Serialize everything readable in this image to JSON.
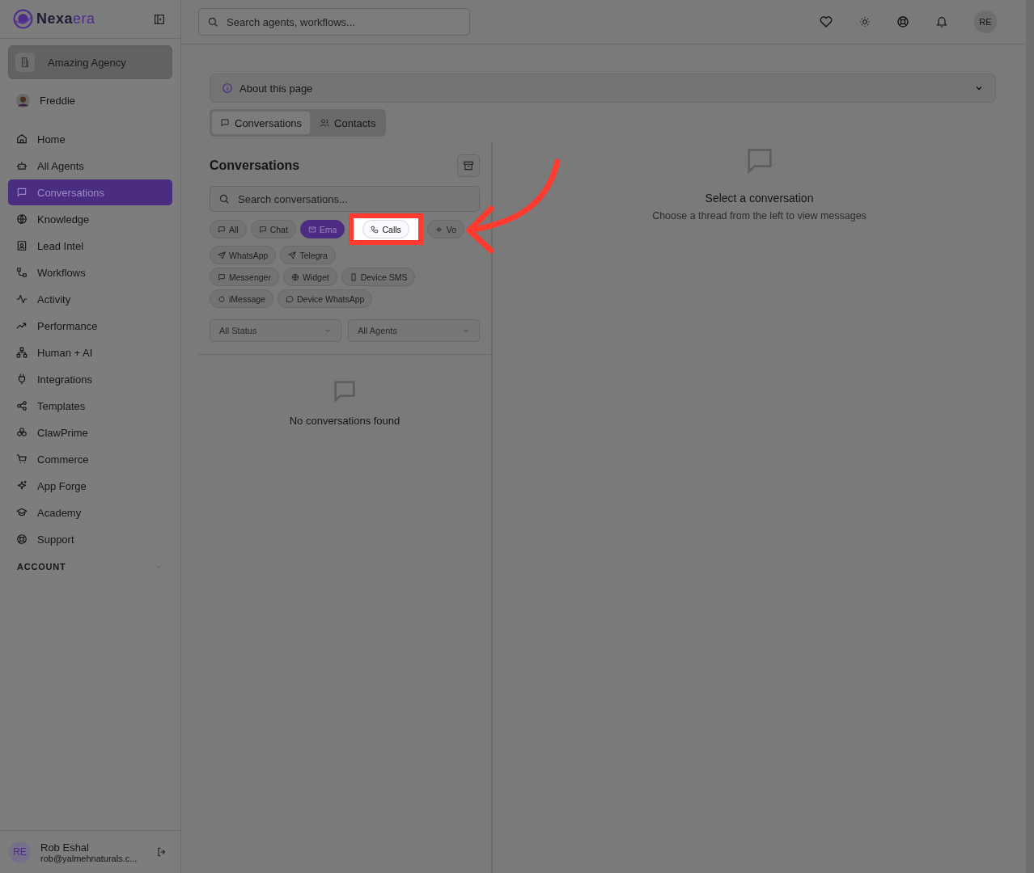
{
  "sidebar": {
    "brand": [
      "Nexa",
      "era"
    ],
    "workspace": "Amazing Agency",
    "user": "Freddie",
    "nav": [
      {
        "label": "Home",
        "selected": false
      },
      {
        "label": "All Agents",
        "selected": false
      },
      {
        "label": "Conversations",
        "selected": true
      },
      {
        "label": "Knowledge",
        "selected": false
      },
      {
        "label": "Lead Intel",
        "selected": false
      },
      {
        "label": "Workflows",
        "selected": false
      },
      {
        "label": "Activity",
        "selected": false
      },
      {
        "label": "Performance",
        "selected": false
      },
      {
        "label": "Human + AI",
        "selected": false
      },
      {
        "label": "Integrations",
        "selected": false
      },
      {
        "label": "Templates",
        "selected": false
      },
      {
        "label": "ClawPrime",
        "selected": false
      },
      {
        "label": "Commerce",
        "selected": false
      },
      {
        "label": "App Forge",
        "selected": false
      },
      {
        "label": "Academy",
        "selected": false
      },
      {
        "label": "Support",
        "selected": false
      }
    ],
    "section": {
      "label": "ACCOUNT",
      "expanded": false
    },
    "account": {
      "initials": "RE",
      "name": "Rob Eshal",
      "email": "rob@yalmehnaturals.c..."
    }
  },
  "topbar": {
    "search": {
      "placeholder": "Search agents, workflows..."
    },
    "avatar": "RE"
  },
  "about": {
    "label": "About this page",
    "expanded": false
  },
  "tabs": [
    {
      "label": "Conversations",
      "selected": true
    },
    {
      "label": "Contacts",
      "selected": false
    }
  ],
  "list_panel": {
    "title": "Conversations",
    "search": {
      "placeholder": "Search conversations..."
    },
    "chip_rows": [
      [
        {
          "label": "All",
          "selected": false,
          "highlighted": false
        },
        {
          "label": "Chat",
          "selected": false,
          "highlighted": false
        },
        {
          "label": "Ema",
          "selected": true,
          "highlighted": false
        },
        {
          "label": "Calls",
          "selected": false,
          "highlighted": true
        },
        {
          "label": "Vo",
          "selected": false,
          "highlighted": false
        }
      ],
      [
        {
          "label": "WhatsApp",
          "selected": false,
          "highlighted": false
        },
        {
          "label": "Telegra",
          "selected": false,
          "highlighted": false
        }
      ],
      [
        {
          "label": "Messenger",
          "selected": false,
          "highlighted": false
        },
        {
          "label": "Widget",
          "selected": false,
          "highlighted": false
        },
        {
          "label": "Device SMS",
          "selected": false,
          "highlighted": false
        }
      ],
      [
        {
          "label": "iMessage",
          "selected": false,
          "highlighted": false
        },
        {
          "label": "Device WhatsApp",
          "selected": false,
          "highlighted": false
        }
      ]
    ],
    "filters": [
      "All Status",
      "All Agents"
    ],
    "empty": "No conversations found"
  },
  "detail": {
    "title": "Select a conversation",
    "subtitle": "Choose a thread from the left to view messages"
  }
}
